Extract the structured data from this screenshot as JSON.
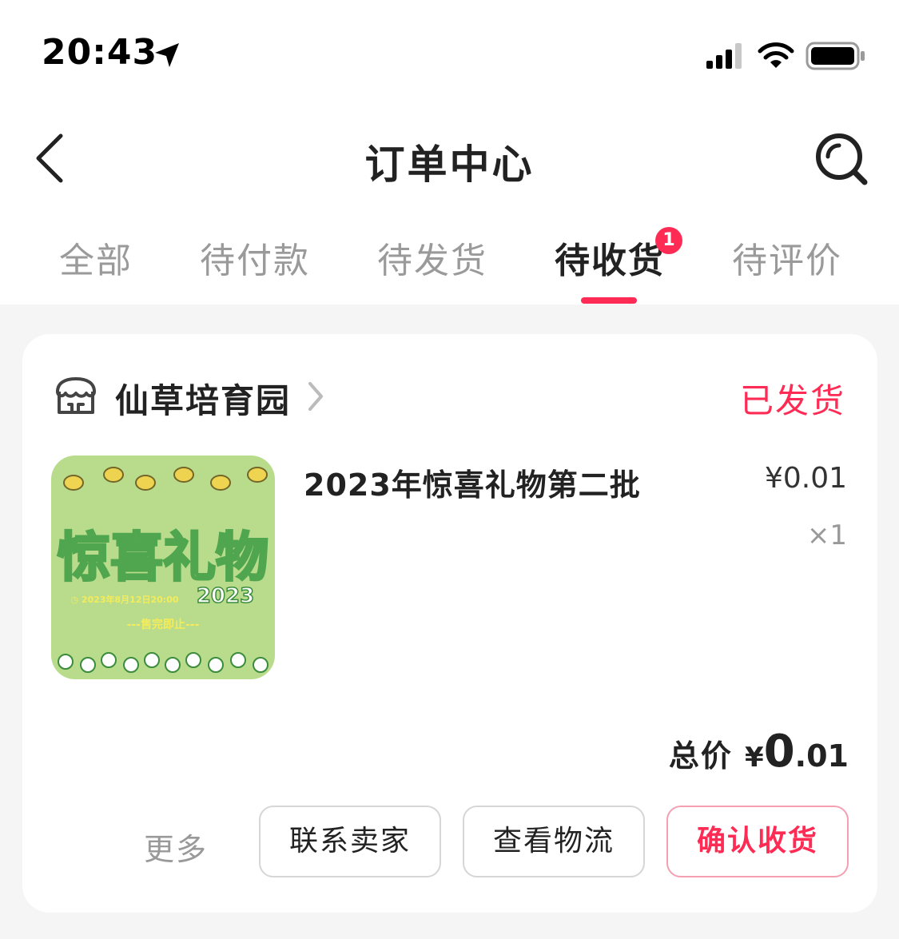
{
  "status_bar": {
    "time": "20:43"
  },
  "nav": {
    "title": "订单中心"
  },
  "tabs": [
    {
      "label": "全部"
    },
    {
      "label": "待付款"
    },
    {
      "label": "待发货"
    },
    {
      "label": "待收货",
      "badge": "1",
      "active": true
    },
    {
      "label": "待评价"
    }
  ],
  "order": {
    "shop_name": "仙草培育园",
    "status": "已发货",
    "product": {
      "title": "2023年惊喜礼物第二批",
      "price": "¥0.01",
      "quantity": "×1",
      "image_text": {
        "headline": "惊喜礼物",
        "year": "2023",
        "date_line": "◷ 2023年8月12日20:00",
        "note": "---售完即止---"
      }
    },
    "total": {
      "label": "总价",
      "currency": "¥",
      "integer": "0",
      "decimal": ".01"
    },
    "actions": {
      "more": "更多",
      "contact_seller": "联系卖家",
      "view_logistics": "查看物流",
      "confirm_receipt": "确认收货"
    }
  },
  "colors": {
    "accent": "#fe2c55",
    "background": "#f5f5f5",
    "thumb_green": "#b9dc8c"
  }
}
